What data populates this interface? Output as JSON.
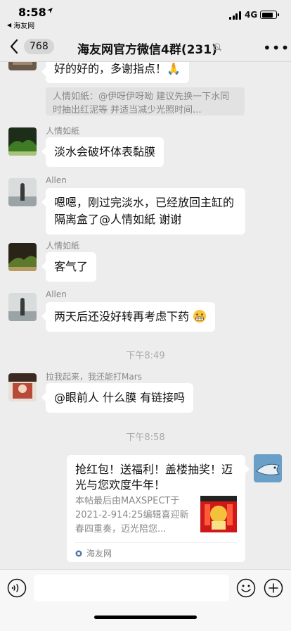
{
  "status_bar": {
    "time": "8:58",
    "back_to_app": "海友网",
    "network": "4G"
  },
  "nav": {
    "unread_count": "768",
    "title": "海友网官方微信4群(231)"
  },
  "messages": [
    {
      "sender": "",
      "text": "好的好的，多谢指点！🙏",
      "quote": "人情如紙：@伊呀伊呀呦 建议先换一下水同时抽出红泥等   并适当减少光照时间..."
    },
    {
      "sender": "人情如紙",
      "text": "淡水会破坏体表黏膜"
    },
    {
      "sender": "Allen",
      "text": "嗯嗯，刚过完淡水，已经放回主缸的隔离盒了@人情如紙 谢谢"
    },
    {
      "sender": "人情如紙",
      "text": "客气了"
    },
    {
      "sender": "Allen",
      "text": "两天后还没好转再考虑下药"
    },
    {
      "sender": "拉我起来，我还能打Mars",
      "text": "@眼前人 什么膜 有链接吗"
    }
  ],
  "time_separators": [
    "下午8:49",
    "下午8:58"
  ],
  "link_card": {
    "title": "抢红包！送福利！盖楼抽奖！迈光与您欢度牛年！",
    "description": "本帖最后由MAXSPECT于2021-2-914:25编辑喜迎新春四重奏，迈光陪您...",
    "source": "海友网"
  },
  "input_bar": {
    "placeholder": ""
  }
}
